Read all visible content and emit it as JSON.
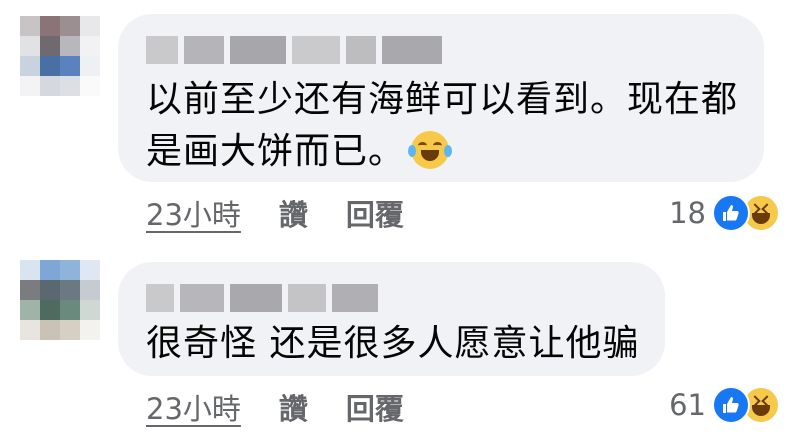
{
  "comments": [
    {
      "text_line1": "以前至少还有海鲜可以看到。现在都",
      "text_line2": "是画大饼而已。",
      "emoji": "face-with-tears-of-joy-icon",
      "time": "23小時",
      "like_label": "讚",
      "reply_label": "回覆",
      "reaction_count": "18"
    },
    {
      "text_line1": "很奇怪 还是很多人愿意让他骗",
      "time": "23小時",
      "like_label": "讚",
      "reply_label": "回覆",
      "reaction_count": "61"
    }
  ],
  "colors": {
    "bubble": "#f0f2f5",
    "text": "#050505",
    "meta": "#65676b",
    "like": "#1877f2",
    "haha": "#f7c94a"
  }
}
